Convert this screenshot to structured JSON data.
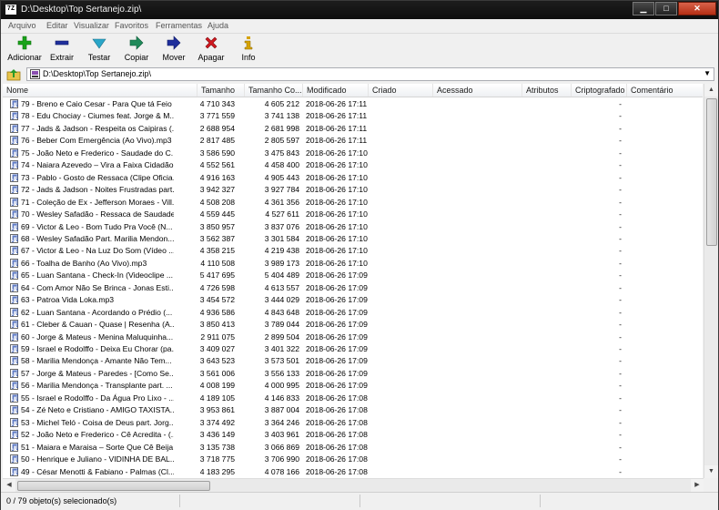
{
  "window": {
    "title": "D:\\Desktop\\Top Sertanejo.zip\\",
    "app_icon_text": "7Z",
    "minimize": "▁",
    "maximize": "□",
    "close": "✕"
  },
  "menu": [
    "Arquivo",
    "Editar",
    "Visualizar",
    "Favoritos",
    "Ferramentas",
    "Ajuda"
  ],
  "toolbar": [
    {
      "label": "Adicionar",
      "icon": "plus-icon",
      "color": "#1aa31a"
    },
    {
      "label": "Extrair",
      "icon": "minus-icon",
      "color": "#1f2f9c"
    },
    {
      "label": "Testar",
      "icon": "check-arrow-icon",
      "color": "#2aa6c8"
    },
    {
      "label": "Copiar",
      "icon": "copy-arrow-icon",
      "color": "#1f8a5a"
    },
    {
      "label": "Mover",
      "icon": "move-arrow-icon",
      "color": "#1f2f9c"
    },
    {
      "label": "Apagar",
      "icon": "delete-x-icon",
      "color": "#d0181f"
    },
    {
      "label": "Info",
      "icon": "info-icon",
      "color": "#d6a300"
    }
  ],
  "address": {
    "path": "D:\\Desktop\\Top Sertanejo.zip\\",
    "dropdown": "▼",
    "up_icon": "up-folder-icon",
    "zip_icon": "zip-file-icon"
  },
  "columns": [
    {
      "label": "Nome",
      "w": 214
    },
    {
      "label": "Tamanho",
      "w": 52
    },
    {
      "label": "Tamanho Co...",
      "w": 64
    },
    {
      "label": "Modificado",
      "w": 72
    },
    {
      "label": "Criado",
      "w": 71
    },
    {
      "label": "Acessado",
      "w": 98
    },
    {
      "label": "Atributos",
      "w": 54
    },
    {
      "label": "Criptografado",
      "w": 61
    },
    {
      "label": "Comentário",
      "w": 84
    }
  ],
  "rows": [
    {
      "name": "79 - Breno e Caio Cesar - Para Que tá Feio ...",
      "size": "4 710 343",
      "packed": "4 605 212",
      "modified": "2018-06-26 17:11",
      "crypt": "-"
    },
    {
      "name": "78 - Edu Chociay - Ciumes feat. Jorge & M...",
      "size": "3 771 559",
      "packed": "3 741 138",
      "modified": "2018-06-26 17:11",
      "crypt": "-"
    },
    {
      "name": "77 - Jads & Jadson - Respeita os Caipiras (...",
      "size": "2 688 954",
      "packed": "2 681 998",
      "modified": "2018-06-26 17:11",
      "crypt": "-"
    },
    {
      "name": "76 - Beber Com Emergência (Ao Vivo).mp3",
      "size": "2 817 485",
      "packed": "2 805 597",
      "modified": "2018-06-26 17:11",
      "crypt": "-"
    },
    {
      "name": "75 - João Neto e Frederico - Saudade do C...",
      "size": "3 586 590",
      "packed": "3 475 843",
      "modified": "2018-06-26 17:10",
      "crypt": "-"
    },
    {
      "name": "74 - Naiara Azevedo – Vira a Faixa Cidadão...",
      "size": "4 552 561",
      "packed": "4 458 400",
      "modified": "2018-06-26 17:10",
      "crypt": "-"
    },
    {
      "name": "73 - Pablo - Gosto de Ressaca (Clipe Oficia...",
      "size": "4 916 163",
      "packed": "4 905 443",
      "modified": "2018-06-26 17:10",
      "crypt": "-"
    },
    {
      "name": "72 - Jads & Jadson - Noites Frustradas part...",
      "size": "3 942 327",
      "packed": "3 927 784",
      "modified": "2018-06-26 17:10",
      "crypt": "-"
    },
    {
      "name": "71 - Coleção de Ex - Jefferson Moraes - Vill...",
      "size": "4 508 208",
      "packed": "4 361 356",
      "modified": "2018-06-26 17:10",
      "crypt": "-"
    },
    {
      "name": "70 - Wesley Safadão - Ressaca de Saudade ...",
      "size": "4 559 445",
      "packed": "4 527 611",
      "modified": "2018-06-26 17:10",
      "crypt": "-"
    },
    {
      "name": "69 - Victor & Leo - Bom Tudo Pra Você (N...",
      "size": "3 850 957",
      "packed": "3 837 076",
      "modified": "2018-06-26 17:10",
      "crypt": "-"
    },
    {
      "name": "68 - Wesley Safadão Part. Marilia Mendon...",
      "size": "3 562 387",
      "packed": "3 301 584",
      "modified": "2018-06-26 17:10",
      "crypt": "-"
    },
    {
      "name": "67 - Victor & Leo - Na Luz Do Som (Vídeo ...",
      "size": "4 358 215",
      "packed": "4 219 438",
      "modified": "2018-06-26 17:10",
      "crypt": "-"
    },
    {
      "name": "66 - Toalha de Banho (Ao Vivo).mp3",
      "size": "4 110 508",
      "packed": "3 989 173",
      "modified": "2018-06-26 17:10",
      "crypt": "-"
    },
    {
      "name": "65 - Luan Santana - Check-In (Videoclipe ...",
      "size": "5 417 695",
      "packed": "5 404 489",
      "modified": "2018-06-26 17:09",
      "crypt": "-"
    },
    {
      "name": "64 - Com Amor Não Se Brinca - Jonas Esti...",
      "size": "4 726 598",
      "packed": "4 613 557",
      "modified": "2018-06-26 17:09",
      "crypt": "-"
    },
    {
      "name": "63 - Patroa Vida Loka.mp3",
      "size": "3 454 572",
      "packed": "3 444 029",
      "modified": "2018-06-26 17:09",
      "crypt": "-"
    },
    {
      "name": "62 - Luan Santana - Acordando o Prédio (...",
      "size": "4 936 586",
      "packed": "4 843 648",
      "modified": "2018-06-26 17:09",
      "crypt": "-"
    },
    {
      "name": "61 - Cleber & Cauan - Quase | Resenha (A...",
      "size": "3 850 413",
      "packed": "3 789 044",
      "modified": "2018-06-26 17:09",
      "crypt": "-"
    },
    {
      "name": "60 - Jorge & Mateus - Menina Maluquinha...",
      "size": "2 911 075",
      "packed": "2 899 504",
      "modified": "2018-06-26 17:09",
      "crypt": "-"
    },
    {
      "name": "59 - Israel e Rodolffo - Deixa Eu Chorar (pa...",
      "size": "3 409 027",
      "packed": "3 401 322",
      "modified": "2018-06-26 17:09",
      "crypt": "-"
    },
    {
      "name": "58 - Marilia Mendonça - Amante Não Tem...",
      "size": "3 643 523",
      "packed": "3 573 501",
      "modified": "2018-06-26 17:09",
      "crypt": "-"
    },
    {
      "name": "57 - Jorge & Mateus - Paredes - [Como Se...",
      "size": "3 561 006",
      "packed": "3 556 133",
      "modified": "2018-06-26 17:09",
      "crypt": "-"
    },
    {
      "name": "56 - Marilia Mendonça - Transplante part. ...",
      "size": "4 008 199",
      "packed": "4 000 995",
      "modified": "2018-06-26 17:09",
      "crypt": "-"
    },
    {
      "name": "55 - Israel e Rodolffo - Da Água Pro Lixo - ...",
      "size": "4 189 105",
      "packed": "4 146 833",
      "modified": "2018-06-26 17:08",
      "crypt": "-"
    },
    {
      "name": "54 - Zé Neto e Cristiano - AMIGO TAXISTA...",
      "size": "3 953 861",
      "packed": "3 887 004",
      "modified": "2018-06-26 17:08",
      "crypt": "-"
    },
    {
      "name": "53 - Michel Teló - Coisa de Deus part. Jorg...",
      "size": "3 374 492",
      "packed": "3 364 246",
      "modified": "2018-06-26 17:08",
      "crypt": "-"
    },
    {
      "name": "52 - João Neto e Frederico - Cê Acredita - (...",
      "size": "3 436 149",
      "packed": "3 403 961",
      "modified": "2018-06-26 17:08",
      "crypt": "-"
    },
    {
      "name": "51 - Maiara e Maraisa – Sorte Que Cê Beija ...",
      "size": "3 135 738",
      "packed": "3 066 869",
      "modified": "2018-06-26 17:08",
      "crypt": "-"
    },
    {
      "name": "50 - Henrique e Juliano - VIDINHA DE BAL...",
      "size": "3 718 775",
      "packed": "3 706 990",
      "modified": "2018-06-26 17:08",
      "crypt": "-"
    },
    {
      "name": "49 - César Menotti & Fabiano - Palmas (Cl...",
      "size": "4 183 295",
      "packed": "4 078 166",
      "modified": "2018-06-26 17:08",
      "crypt": "-"
    }
  ],
  "status": {
    "text": "0 / 79 objeto(s) selecionado(s)"
  },
  "scroll": {
    "up": "▲",
    "down": "▼",
    "left": "◀",
    "right": "▶"
  }
}
